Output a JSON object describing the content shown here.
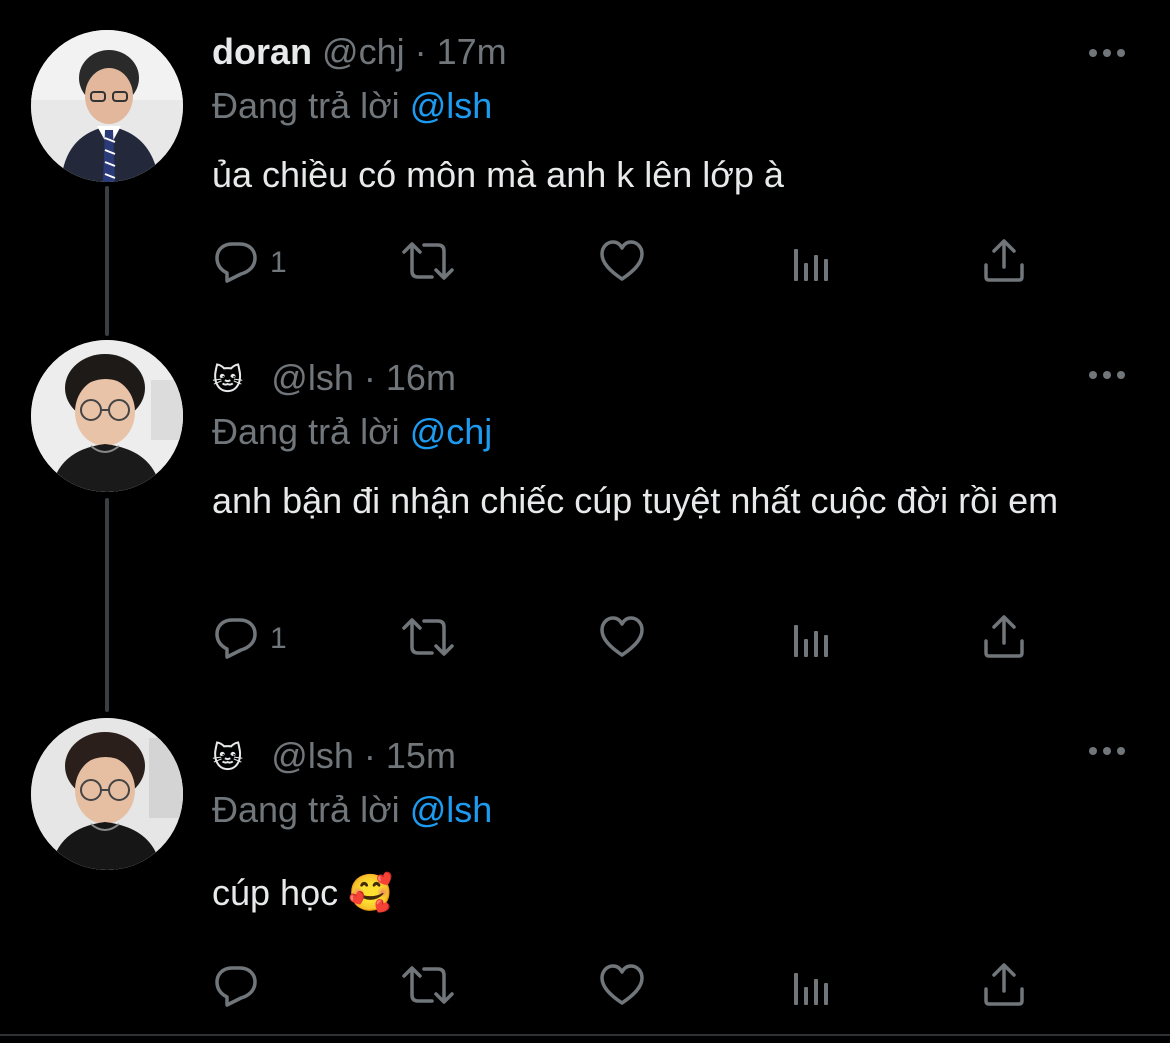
{
  "tweets": [
    {
      "name": "doran",
      "handle": "@chj",
      "dot": "·",
      "time": "17m",
      "reply_prefix": "Đang trả lời",
      "reply_to": "@lsh",
      "text": "ủa chiều có môn mà anh k lên lớp à",
      "reply_count": "1"
    },
    {
      "name_emoji": "🐱",
      "handle": "@lsh",
      "dot": "·",
      "time": "16m",
      "reply_prefix": "Đang trả lời",
      "reply_to": "@chj",
      "text": "anh bận đi nhận chiếc cúp tuyệt nhất cuộc đời rồi em",
      "reply_count": "1"
    },
    {
      "name_emoji": "🐱",
      "handle": "@lsh",
      "dot": "·",
      "time": "15m",
      "reply_prefix": "Đang trả lời",
      "reply_to": "@lsh",
      "text": "cúp học 🥰",
      "reply_count": ""
    }
  ],
  "icons": [
    "reply-icon",
    "retweet-icon",
    "like-icon",
    "analytics-icon",
    "share-icon",
    "more-icon"
  ],
  "colors": {
    "background": "#000000",
    "text": "#e7e9ea",
    "muted": "#71767b",
    "link": "#1d9bf0",
    "thread_line": "#3a3f44"
  }
}
